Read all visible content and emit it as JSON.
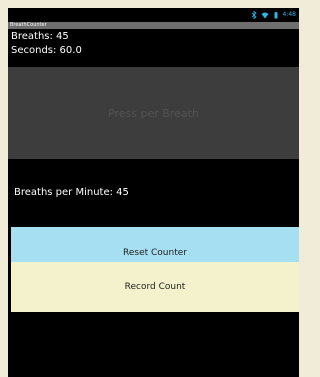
{
  "app": {
    "title": "BreathCounter"
  },
  "status_bar": {
    "time": "4:48"
  },
  "counts": {
    "breaths_label": "Breaths: 45",
    "seconds_label": "Seconds: 60.0"
  },
  "breath_button": {
    "label": "Press per Breath"
  },
  "rate": {
    "label": "Breaths per Minute: 45"
  },
  "actions": {
    "reset_label": "Reset Counter",
    "record_label": "Record Count"
  },
  "colors": {
    "status_accent": "#33b5e5",
    "breath_button_bg": "#3d3d3d",
    "reset_button_bg": "#a6dff2",
    "record_button_bg": "#f3f2cc",
    "screen_bg": "#000000",
    "frame_bg": "#f1ecd7"
  }
}
